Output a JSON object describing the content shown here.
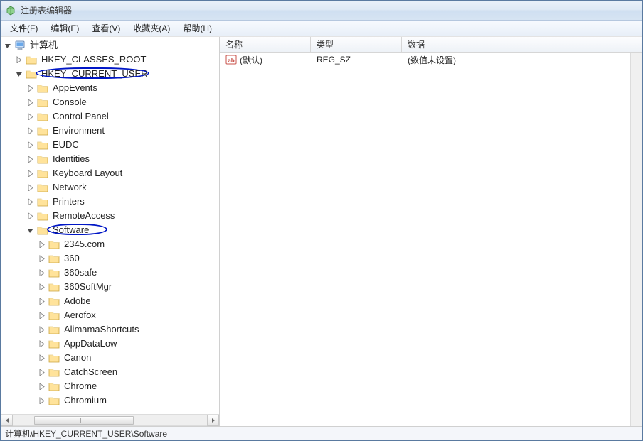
{
  "window": {
    "title": "注册表编辑器"
  },
  "menu": {
    "items": [
      {
        "label": "文件(F)"
      },
      {
        "label": "编辑(E)"
      },
      {
        "label": "查看(V)"
      },
      {
        "label": "收藏夹(A)"
      },
      {
        "label": "帮助(H)"
      }
    ]
  },
  "tree": {
    "root_label": "计算机",
    "hkcr": "HKEY_CLASSES_ROOT",
    "hkcu": "HKEY_CURRENT_USER",
    "hkcu_children": [
      "AppEvents",
      "Console",
      "Control Panel",
      "Environment",
      "EUDC",
      "Identities",
      "Keyboard Layout",
      "Network",
      "Printers",
      "RemoteAccess"
    ],
    "software_label": "Software",
    "software_children": [
      "2345.com",
      "360",
      "360safe",
      "360SoftMgr",
      "Adobe",
      "Aerofox",
      "AlimamaShortcuts",
      "AppDataLow",
      "Canon",
      "CatchScreen",
      "Chrome",
      "Chromium"
    ]
  },
  "list": {
    "columns": {
      "name": "名称",
      "type": "类型",
      "data": "数据"
    },
    "rows": [
      {
        "name": "(默认)",
        "type": "REG_SZ",
        "data": "(数值未设置)"
      }
    ]
  },
  "status": {
    "path": "计算机\\HKEY_CURRENT_USER\\Software"
  }
}
